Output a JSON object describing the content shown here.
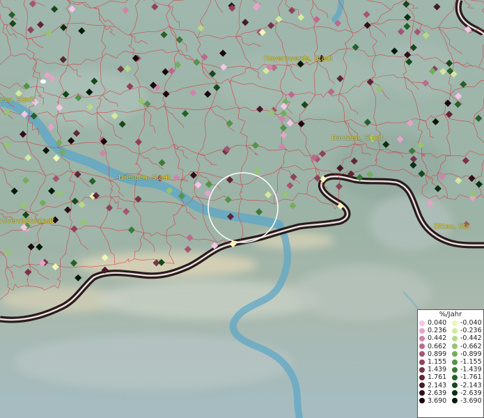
{
  "map": {
    "labels": [
      {
        "id": "hoyerswerda",
        "text": "Hoyerswerda, Stadt"
      },
      {
        "id": "riesa",
        "text": "esa, Stadt"
      },
      {
        "id": "bautzen",
        "text": "Bautzen, Stadt"
      },
      {
        "id": "dresden",
        "text": "Dresden, Stadt"
      },
      {
        "id": "universitaetsstadt",
        "text": "niversitätsstadt"
      },
      {
        "id": "zittau",
        "text": "Zittau, Sta"
      }
    ]
  },
  "legend": {
    "title": "%/Jahr",
    "positive": [
      {
        "value": "0.040",
        "color": "#f4c6e6"
      },
      {
        "value": "0.236",
        "color": "#e6a3c8"
      },
      {
        "value": "0.442",
        "color": "#d184aa"
      },
      {
        "value": "0.662",
        "color": "#bb6a8c"
      },
      {
        "value": "0.899",
        "color": "#a55572"
      },
      {
        "value": "1.155",
        "color": "#8e435b"
      },
      {
        "value": "1.439",
        "color": "#763447"
      },
      {
        "value": "1.761",
        "color": "#5e2636"
      },
      {
        "value": "2.143",
        "color": "#451a27"
      },
      {
        "value": "2.639",
        "color": "#2e1019"
      },
      {
        "value": "3.690",
        "color": "#1a070d"
      }
    ],
    "negative": [
      {
        "value": "-0.040",
        "color": "#eef6b8"
      },
      {
        "value": "-0.236",
        "color": "#d3ea9e"
      },
      {
        "value": "-0.442",
        "color": "#b6d987"
      },
      {
        "value": "-0.662",
        "color": "#95c472"
      },
      {
        "value": "-0.899",
        "color": "#74ad5d"
      },
      {
        "value": "-1.155",
        "color": "#54934a"
      },
      {
        "value": "-1.439",
        "color": "#3a7a39"
      },
      {
        "value": "-1.761",
        "color": "#256129"
      },
      {
        "value": "-2.143",
        "color": "#16481c"
      },
      {
        "value": "-2.639",
        "color": "#0b3011"
      },
      {
        "value": "-3.690",
        "color": "#041a08"
      }
    ]
  }
}
